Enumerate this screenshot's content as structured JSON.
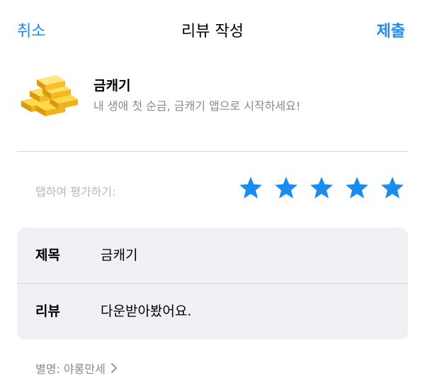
{
  "nav": {
    "cancel": "취소",
    "title": "리뷰 작성",
    "submit": "제출"
  },
  "app": {
    "name": "금캐기",
    "subtitle": "내 생애 첫 순금, 금캐기 앱으로 시작하세요!",
    "icon": "gold-bars-icon"
  },
  "rating": {
    "label": "탭하여 평가하기:",
    "stars": 5,
    "max": 5,
    "color": "#1a8cf0"
  },
  "form": {
    "title_label": "제목",
    "title_value": "금캐기",
    "review_label": "리뷰",
    "review_value": "다운받아봤어요."
  },
  "nickname": {
    "text": "별명: 야롱만세",
    "icon": "chevron-right-icon"
  },
  "colors": {
    "accent": "#1a8cf0",
    "secondary_text": "#8a8a8e",
    "card_bg": "#f1f1f5"
  }
}
